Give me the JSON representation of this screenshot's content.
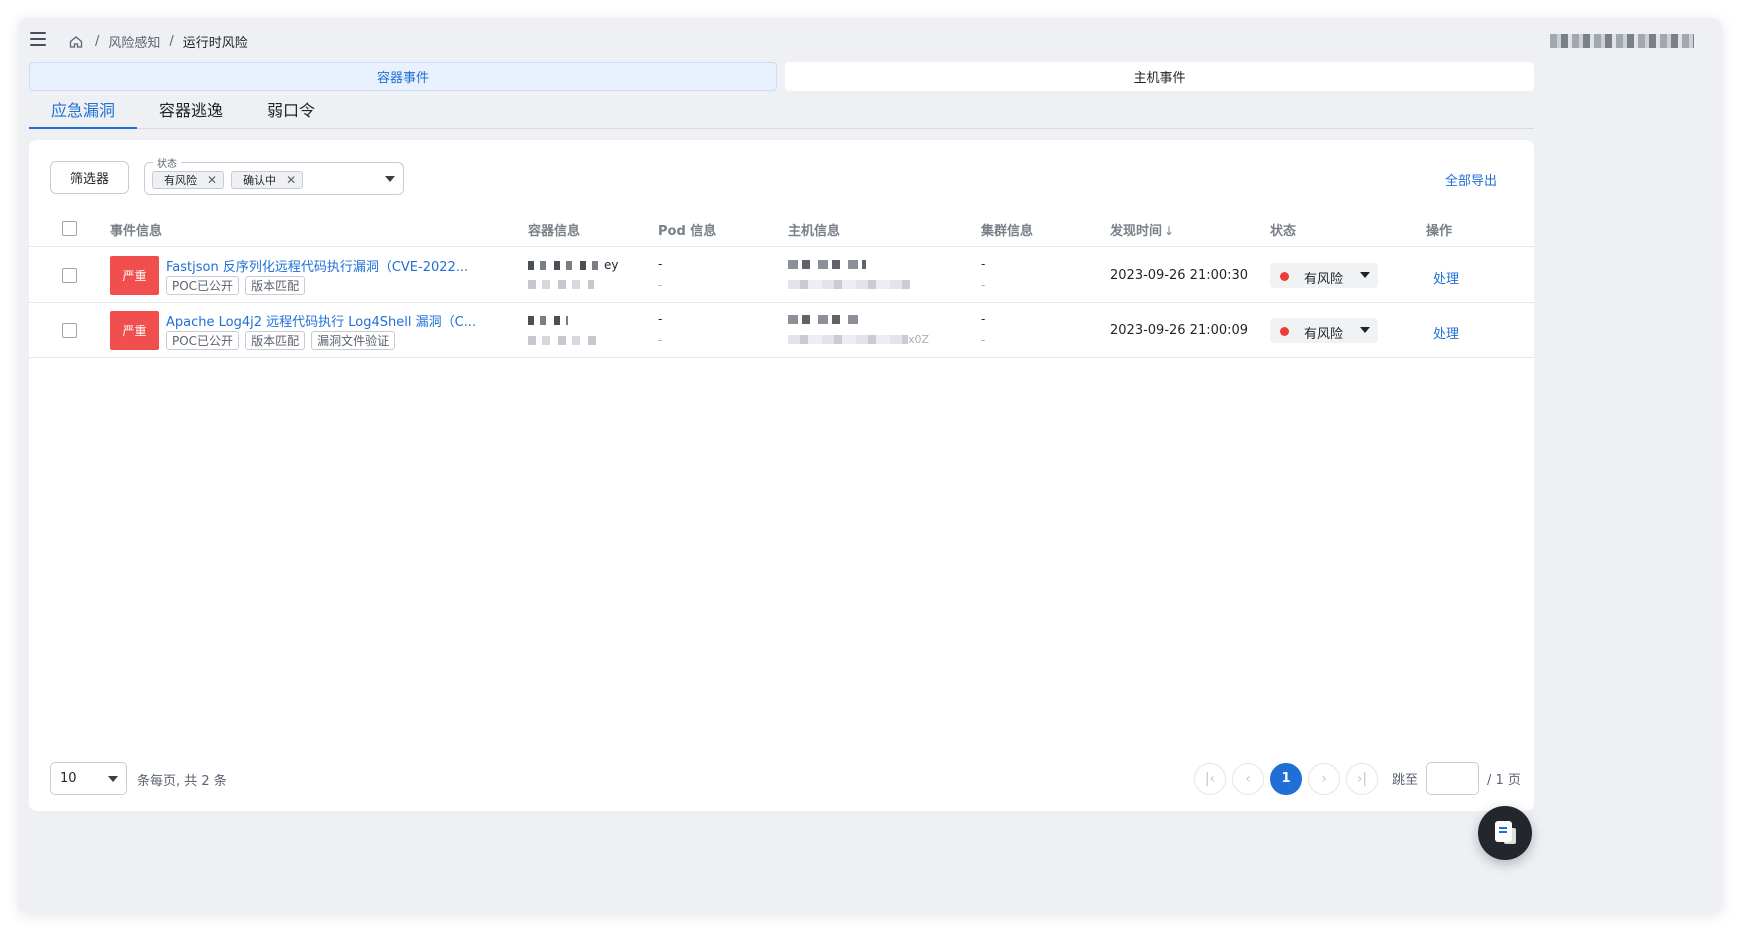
{
  "breadcrumb": {
    "items": [
      "风险感知",
      "运行时风险"
    ]
  },
  "segments": {
    "left": "容器事件",
    "right": "主机事件"
  },
  "tabs": [
    "应急漏洞",
    "容器逃逸",
    "弱口令"
  ],
  "filter": {
    "button": "筛选器",
    "status_legend": "状态",
    "chips": [
      "有风险",
      "确认中"
    ],
    "export": "全部导出"
  },
  "table": {
    "headers": [
      "事件信息",
      "容器信息",
      "Pod 信息",
      "主机信息",
      "集群信息",
      "发现时间",
      "状态",
      "操作"
    ],
    "rows": [
      {
        "severity": "严重",
        "title": "Fastjson 反序列化远程代码执行漏洞（CVE-2022...",
        "tags": [
          "POC已公开",
          "版本匹配"
        ],
        "container_tail": "ey",
        "pod_main": "-",
        "pod_sub": "-",
        "host_tail": "",
        "cluster_main": "-",
        "cluster_sub": "-",
        "time": "2023-09-26 21:00:30",
        "status": "有风险",
        "action": "处理"
      },
      {
        "severity": "严重",
        "title": "Apache Log4j2 远程代码执行 Log4Shell 漏洞（C...",
        "tags": [
          "POC已公开",
          "版本匹配",
          "漏洞文件验证"
        ],
        "container_tail": "",
        "pod_main": "-",
        "pod_sub": "-",
        "host_tail": "x0Z",
        "cluster_main": "-",
        "cluster_sub": "-",
        "time": "2023-09-26 21:00:09",
        "status": "有风险",
        "action": "处理"
      }
    ]
  },
  "pagination": {
    "page_size": "10",
    "info": "条每页, 共 2 条",
    "current": "1",
    "jump_label": "跳至",
    "total": "/ 1 页"
  },
  "colors": {
    "accent": "#1f6fd6",
    "severity": "#f14e4e",
    "risk_dot": "#f03a3a"
  },
  "icons": {
    "home": "home-icon",
    "menu": "menu-icon",
    "fab": "document-icon"
  }
}
